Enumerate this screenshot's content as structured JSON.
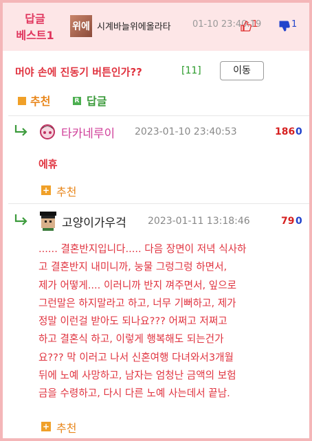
{
  "header": {
    "badge_line1": "답글",
    "badge_line2": "베스트1",
    "avatar_text": "위에",
    "username": "시계바늘위에올라타",
    "datetime": "01-10 23:40:19",
    "upvotes": "1",
    "downvotes": "1"
  },
  "post": {
    "title": "머야 손에 진동기 버튼인가??",
    "reply_count": "[11]",
    "move_button": "이동",
    "action_recommend": "추천",
    "action_reply": "답글"
  },
  "comments": [
    {
      "username": "타카네루이",
      "username_color": "#d0409a",
      "datetime": "2023-01-10 23:40:53",
      "upvotes": "186",
      "downvotes": "0",
      "body_lines": [
        "에휴"
      ],
      "recommend": "추천"
    },
    {
      "username": "고양이가우걱",
      "username_color": "#222222",
      "datetime": "2023-01-11 13:18:46",
      "upvotes": "79",
      "downvotes": "0",
      "body_lines": [
        "...... 결혼반지입니다..... 다음 장면이 저녁 식사하",
        "고 결혼반지 내미니까, 눙물 그렁그렁 하면서,",
        "제가 어떻게.... 이러니까 반지 껴주면서, 잎으로",
        "그런말은 하지말라고 하고, 너무 기뻐하고, 제가",
        "정말 이런걸 받아도 되나요??? 어쩌고 저쩌고",
        "하고 결혼식 하고, 이렇게 행복해도 되는건가",
        "요??? 막 이러고 나서 신혼여행 다녀와서3개월",
        "뒤에 노예 사망하고, 남자는 엄청난 금액의 보험",
        "금을 수령하고, 다시 다른 노예 사는데서 끝남."
      ],
      "recommend": "추천"
    }
  ]
}
